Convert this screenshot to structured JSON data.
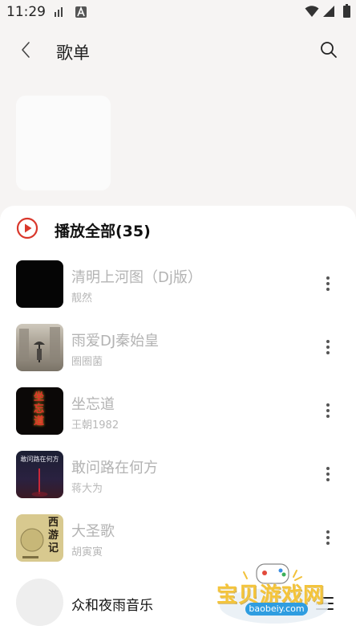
{
  "status_bar": {
    "time": "11:29"
  },
  "header": {
    "title": "歌单"
  },
  "play_all": {
    "label": "播放全部(35)"
  },
  "songs": [
    {
      "title": "清明上河图（Dj版）",
      "artist": "靓然"
    },
    {
      "title": "雨爱DJ秦始皇",
      "artist": "圈圈菌"
    },
    {
      "title": "坐忘道",
      "artist": "王朝1982"
    },
    {
      "title": "敢问路在何方",
      "artist": "蒋大为"
    },
    {
      "title": "大圣歌",
      "artist": "胡寅寅"
    }
  ],
  "cover_texts": {
    "song3": "坐忘道",
    "song4": "敢问路在何方",
    "song5": "西游记"
  },
  "mini_player": {
    "title": "众和夜雨音乐"
  },
  "watermark": {
    "text": "宝贝游戏网",
    "url": "baobeiy.com"
  },
  "colors": {
    "accent": "#d9372b",
    "text_primary": "#111111",
    "text_muted": "#b3b3b3",
    "background": "#f6f4f3"
  }
}
